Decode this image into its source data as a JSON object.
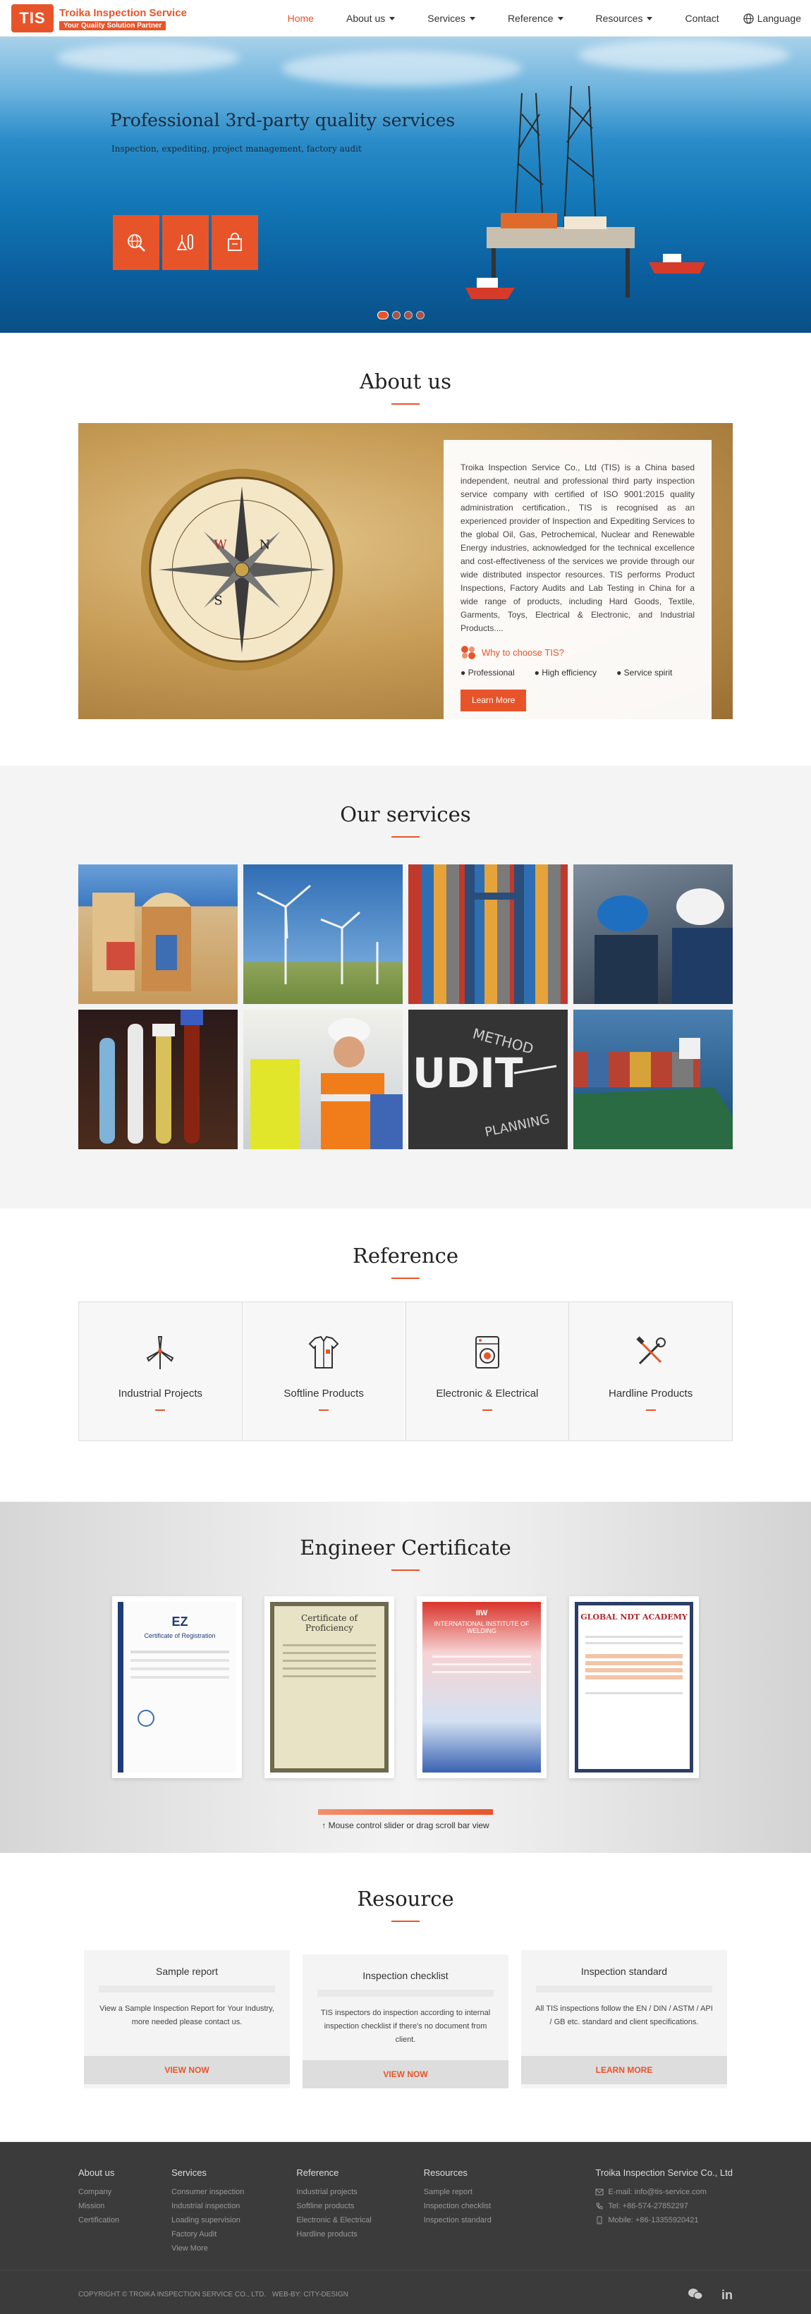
{
  "header": {
    "logo_mark": "TIS",
    "logo_name": "Troika Inspection Service",
    "logo_slogan": "Your Quality Solution Partner",
    "nav": [
      {
        "label": "Home",
        "active": true,
        "dropdown": false
      },
      {
        "label": "About us",
        "active": false,
        "dropdown": true
      },
      {
        "label": "Services",
        "active": false,
        "dropdown": true
      },
      {
        "label": "Reference",
        "active": false,
        "dropdown": true
      },
      {
        "label": "Resources",
        "active": false,
        "dropdown": true
      },
      {
        "label": "Contact",
        "active": false,
        "dropdown": false
      }
    ],
    "language_label": "Language",
    "language_icon": "globe-icon"
  },
  "hero": {
    "title": "Professional 3rd-party quality services",
    "subtitle": "Inspection, expediting, project management, factory audit",
    "buttons": [
      "search-globe-icon",
      "lab-flask-icon",
      "shopping-bag-icon"
    ],
    "slide_count": 4,
    "active_slide": 1
  },
  "about": {
    "title": "About us",
    "text": "Troika Inspection Service Co., Ltd (TIS) is a China based independent, neutral and professional third party inspection service company with certified of ISO 9001:2015 quality administration certification., TIS is recognised as an experienced provider of Inspection and Expediting Services to the global Oil, Gas, Petrochemical, Nuclear and Renewable Energy industries, acknowledged for the technical excellence and cost-effectiveness of the services we provide through our wide distributed inspector resources. TIS performs Product Inspections, Factory Audits and Lab Testing in China for a wide range of products, including Hard Goods, Textile, Garments, Toys, Electrical & Electronic, and Industrial Products....",
    "why_label": "Why to choose TIS?",
    "points": [
      "Professional",
      "High efficiency",
      "Service spirit"
    ],
    "button": "Learn More"
  },
  "services": {
    "title": "Our services",
    "tiles": [
      "toy-blocks",
      "wind-turbines",
      "container-terminal",
      "engineers-hardhat",
      "test-tubes",
      "construction-workers",
      "audit-chalkboard",
      "container-ship"
    ]
  },
  "reference": {
    "title": "Reference",
    "items": [
      {
        "label": "Industrial Projects",
        "icon": "wind-turbine-icon"
      },
      {
        "label": "Softline Products",
        "icon": "shirt-icon"
      },
      {
        "label": "Electronic & Electrical",
        "icon": "washing-machine-icon"
      },
      {
        "label": "Hardline Products",
        "icon": "tools-icon"
      }
    ]
  },
  "certificates": {
    "title": "Engineer Certificate",
    "cards": [
      {
        "heading": "Certificate of Registration",
        "brand": "EZ"
      },
      {
        "heading": "Certificate of Proficiency",
        "brand": ""
      },
      {
        "heading": "INTERNATIONAL INSTITUTE OF WELDING",
        "brand": "IIW"
      },
      {
        "heading": "GLOBAL NDT ACADEMY",
        "brand": ""
      }
    ],
    "scroll_hint": "↑ Mouse control slider or drag scroll bar view"
  },
  "resource": {
    "title": "Resource",
    "cards": [
      {
        "title": "Sample report",
        "body": "View a Sample Inspection Report for Your Industry, more needed please contact us.",
        "button": "VIEW NOW"
      },
      {
        "title": "Inspection checklist",
        "body": "TIS inspectors do inspection according to internal inspection checklist if there's no document from client.",
        "button": "VIEW NOW"
      },
      {
        "title": "Inspection standard",
        "body": "All TIS inspections follow the EN / DIN / ASTM / API / GB etc. standard and client specifications.",
        "button": "LEARN MORE"
      }
    ]
  },
  "footer": {
    "columns": [
      {
        "title": "About us",
        "links": [
          "Company",
          "Mission",
          "Certification"
        ]
      },
      {
        "title": "Services",
        "links": [
          "Consumer inspection",
          "Industrial inspection",
          "Loading supervision",
          "Factory Audit",
          "View More"
        ]
      },
      {
        "title": "Reference",
        "links": [
          "Industrial projects",
          "Softline products",
          "Electronic & Electrical",
          "Hardline products"
        ]
      },
      {
        "title": "Resources",
        "links": [
          "Sample report",
          "Inspection checklist",
          "Inspection standard"
        ]
      }
    ],
    "company": "Troika Inspection Service Co., Ltd",
    "email": "E-mail: info@tis-service.com",
    "tel": "Tel: +86-574-27852297",
    "mobile": "Mobile: +86-13355920421",
    "copyright": "COPYRIGHT © TROIKA INSPECTION SERVICE CO., LTD.",
    "web_by": "WEB-BY: CITY-DESIGN",
    "social": [
      "wechat-icon",
      "linkedin-icon"
    ]
  },
  "colors": {
    "accent": "#e8542a",
    "footer_bg": "#3b3b3b",
    "section_gray": "#f4f4f4"
  }
}
